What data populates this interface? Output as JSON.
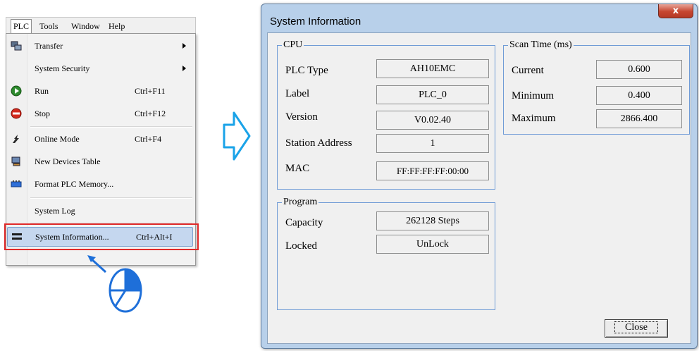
{
  "menubar": {
    "items": [
      "PLC",
      "Tools",
      "Window",
      "Help"
    ]
  },
  "menu": {
    "items": [
      {
        "label": "Transfer",
        "shortcut": "",
        "icon": "transfer-icon"
      },
      {
        "label": "System Security",
        "shortcut": "",
        "icon": ""
      },
      {
        "label": "Run",
        "shortcut": "Ctrl+F11",
        "icon": "run-icon"
      },
      {
        "label": "Stop",
        "shortcut": "Ctrl+F12",
        "icon": "stop-icon"
      },
      {
        "label": "Online Mode",
        "shortcut": "Ctrl+F4",
        "icon": "online-mode-icon"
      },
      {
        "label": "New Devices Table",
        "shortcut": "",
        "icon": "devices-table-icon"
      },
      {
        "label": "Format PLC Memory...",
        "shortcut": "",
        "icon": "format-memory-icon"
      },
      {
        "label": "System Log",
        "shortcut": "",
        "icon": ""
      },
      {
        "label": "System Information...",
        "shortcut": "Ctrl+Alt+I",
        "icon": "system-information-icon"
      }
    ]
  },
  "dialog": {
    "title": "System Information",
    "close_glyph": "x",
    "cpu": {
      "title": "CPU",
      "rows": [
        {
          "label": "PLC Type",
          "value": "AH10EMC"
        },
        {
          "label": "Label",
          "value": "PLC_0"
        },
        {
          "label": "Version",
          "value": "V0.02.40"
        },
        {
          "label": "Station Address",
          "value": "1"
        },
        {
          "label": "MAC",
          "value": "FF:FF:FF:FF:00:00"
        }
      ]
    },
    "scan": {
      "title": "Scan Time (ms)",
      "rows": [
        {
          "label": "Current",
          "value": "0.600"
        },
        {
          "label": "Minimum",
          "value": "0.400"
        },
        {
          "label": "Maximum",
          "value": "2866.400"
        }
      ]
    },
    "program": {
      "title": "Program",
      "rows": [
        {
          "label": "Capacity",
          "value": "262128 Steps"
        },
        {
          "label": "Locked",
          "value": "UnLock"
        }
      ]
    },
    "close_button": "Close"
  },
  "colors": {
    "highlight": "#c5d7ef",
    "red_box": "#e12a2a",
    "arrow": "#1aa3e8",
    "dialog_frame": "#b8d0ea"
  }
}
